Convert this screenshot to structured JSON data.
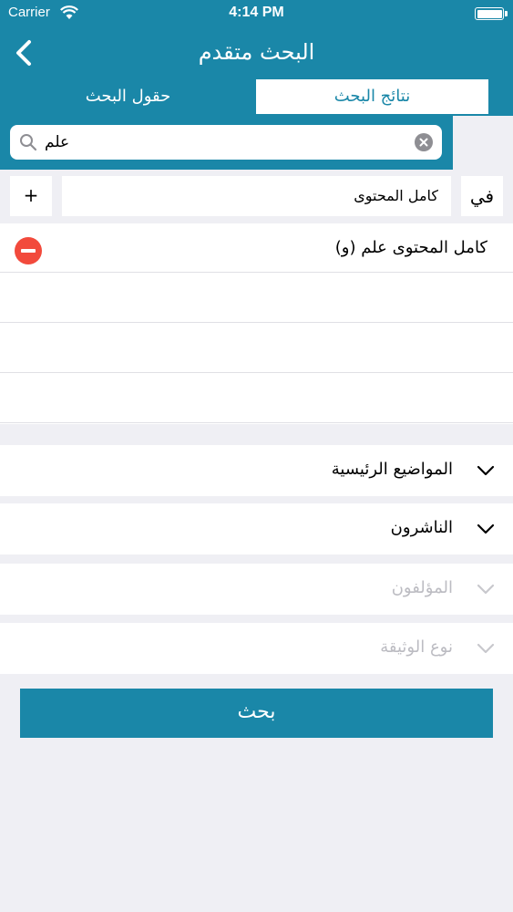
{
  "status": {
    "carrier": "Carrier",
    "time": "4:14 PM"
  },
  "nav": {
    "title": "البحث متقدم"
  },
  "tabs": [
    {
      "label": "نتائج البحث",
      "selected": true
    },
    {
      "label": "حقول البحث",
      "selected": false
    }
  ],
  "search": {
    "value": "علم",
    "placeholder": ""
  },
  "filter": {
    "add_label": "+",
    "field": "كامل المحتوى",
    "in_label": "في"
  },
  "criteria": [
    {
      "text": "(و) كامل المحتوى علم"
    }
  ],
  "sections": [
    {
      "label": "المواضيع الرئيسية",
      "enabled": true
    },
    {
      "label": "الناشرون",
      "enabled": true
    },
    {
      "label": "المؤلفون",
      "enabled": false
    },
    {
      "label": "نوع الوثيقة",
      "enabled": false
    }
  ],
  "submit": {
    "label": "بحث"
  },
  "colors": {
    "primary": "#1a87a8",
    "remove": "#f24a3c",
    "background": "#efeff4"
  }
}
